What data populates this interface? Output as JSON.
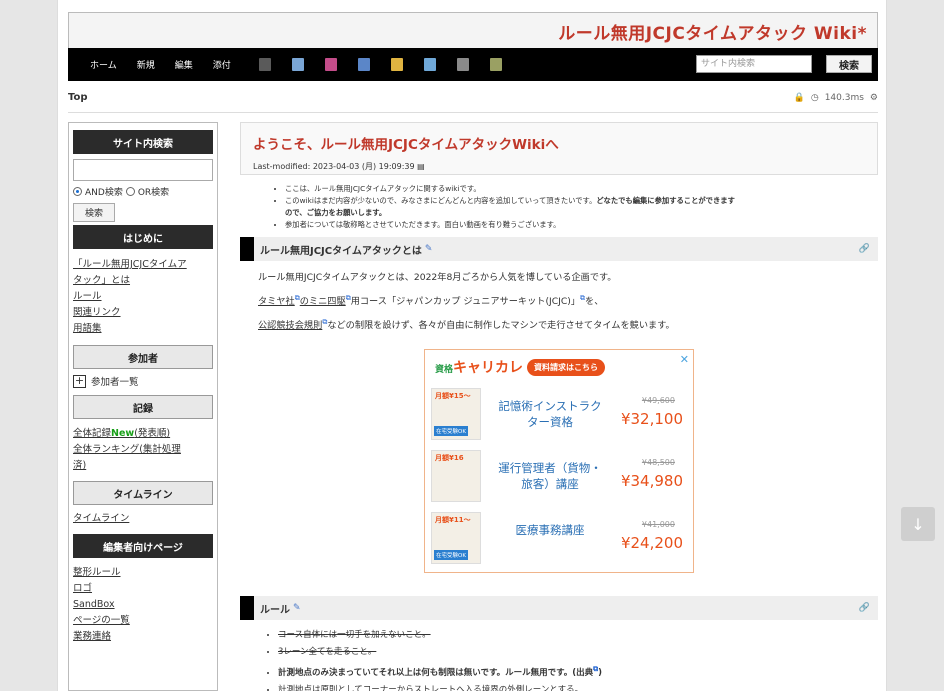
{
  "site": {
    "title": "ルール無用JCJCタイムアタック Wiki*"
  },
  "nav": {
    "home": "ホーム",
    "new": "新規",
    "edit": "編集",
    "attach": "添付",
    "search_placeholder": "サイト内検索",
    "search_button": "検索",
    "icon_colors": [
      "#5a5a5a",
      "#7aa6d6",
      "#c44d8a",
      "#5b86c8",
      "#e0b441",
      "#6fa8d8",
      "#8a8a8a",
      "#9aa063"
    ]
  },
  "crumb": {
    "top": "Top",
    "timing": "140.3ms"
  },
  "sidebar": {
    "search_heading": "サイト内検索",
    "and_label": "AND検索",
    "or_label": "OR検索",
    "search_button": "検索",
    "hajime_heading": "はじめに",
    "hajime_links": [
      "「ルール無用JCJCタイムア",
      "タック」とは",
      "ルール",
      "関連リンク",
      "用語集"
    ],
    "participants_heading": "参加者",
    "participants_link": "参加者一覧",
    "records_heading": "記録",
    "records_link1_a": "全体記録",
    "records_link1_new": "New",
    "records_link1_b": "(発表順)",
    "records_link2_a": "全体ランキング(集計処理",
    "records_link2_b": "済)",
    "timeline_heading": "タイムライン",
    "timeline_link": "タイムライン",
    "editor_heading": "編集者向けページ",
    "editor_links": [
      "整形ルール",
      "ロゴ",
      "SandBox",
      "ページの一覧",
      "業務連絡"
    ]
  },
  "main": {
    "title": "ようこそ、ルール無用JCJCタイムアタックWikiへ",
    "last_modified": "Last-modified: 2023-04-03 (月) 19:09:39",
    "intro": [
      "ここは、ルール無用JCJCタイムアタックに関するwikiです。",
      "このwikiはまだ内容が少ないので、みなさまにどんどんと内容を追加していって頂きたいです。",
      "どなたでも編集に参加することができます",
      "ので、ご協力をお願いします。",
      "参加者については敬称略とさせていただきます。面白い動画を有り難うございます。"
    ],
    "sec1_heading": "ルール無用JCJCタイムアタックとは",
    "sec1_p1": "ルール無用JCJCタイムアタックとは、2022年8月ごろから人気を博している企画です。",
    "sec1_p2_a": "タミヤ社",
    "sec1_p2_b": "のミニ四駆",
    "sec1_p2_c": "用コース「ジャパンカップ ジュニアサーキット(JCJC)」",
    "sec1_p2_d": "を、",
    "sec1_p3_a": "公認競技会規則",
    "sec1_p3_b": "などの制限を設けず、各々が自由に制作したマシンで走行させてタイムを競います。",
    "sec2_heading": "ルール",
    "rules": [
      "コース自体には一切手を加えないこと。",
      "3レーン全てを走ること。",
      "計測地点のみ決まっていてそれ以上は何も制限は無いです。ルール無用です。(出典",
      "計測地点は原則としてコーナーからストレートへ入る境界の外側レーンとする。"
    ]
  },
  "ad": {
    "brand_small": "資格",
    "brand": "キャリカレ",
    "pill": "資料請求はこちら",
    "items": [
      {
        "tag": "月額¥15〜",
        "label": "在宅受験OK",
        "title": "記憶術インストラクター資格",
        "old": "¥49,600",
        "price": "¥32,100"
      },
      {
        "tag": "月額¥16",
        "label": "",
        "title": "運行管理者（貨物・旅客）講座",
        "old": "¥48,500",
        "price": "¥34,980"
      },
      {
        "tag": "月額¥11〜",
        "label": "在宅受験OK",
        "title": "医療事務講座",
        "old": "¥41,000",
        "price": "¥24,200"
      }
    ]
  }
}
